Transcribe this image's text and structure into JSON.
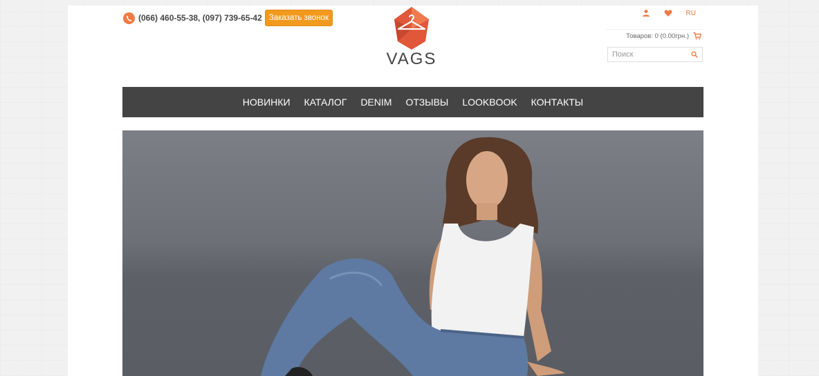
{
  "header": {
    "phones": "(066) 460-55-38, (097) 739-65-42",
    "call_button": "Заказать звонок",
    "logo_text": "VAGS",
    "lang": "RU",
    "cart": "Товаров: 0 (0.00грн.)",
    "search_placeholder": "Поиск"
  },
  "nav": {
    "items": [
      "НОВИНКИ",
      "КАТАЛОГ",
      "DENIM",
      "ОТЗЫВЫ",
      "LOOKBOOK",
      "КОНТАКТЫ"
    ]
  },
  "colors": {
    "accent": "#f07a44",
    "button": "#f29a1d",
    "nav_bg": "#444444"
  }
}
